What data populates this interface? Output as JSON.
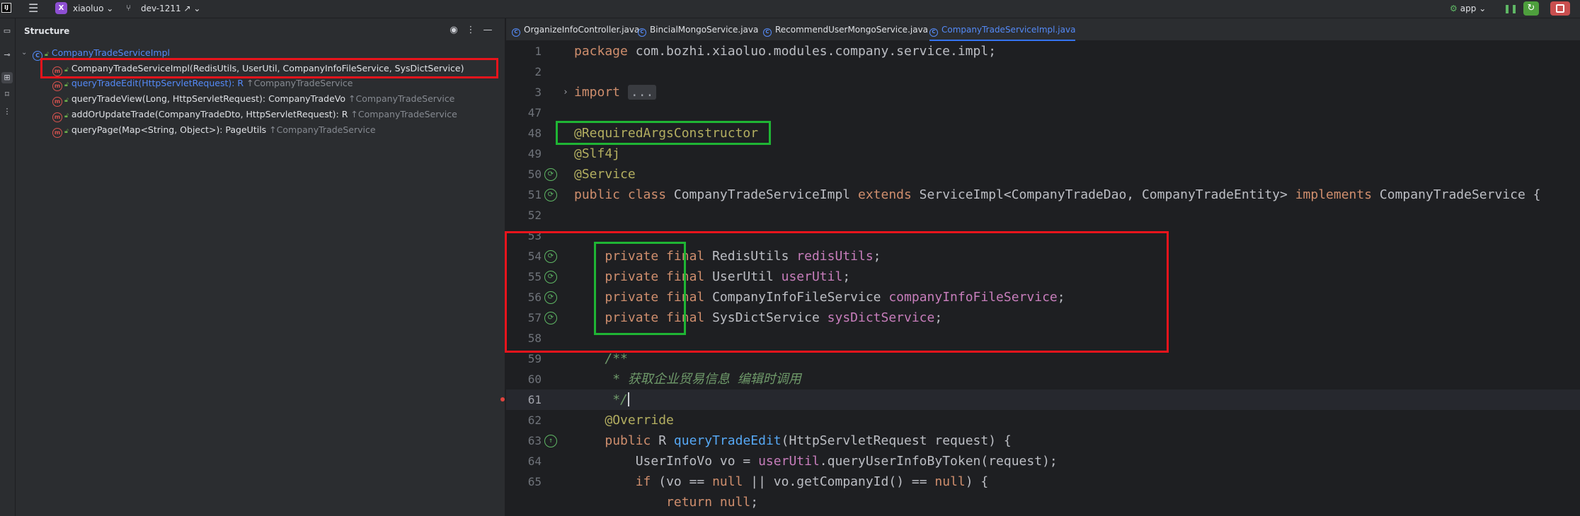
{
  "titlebar": {
    "app_logo": "IJ",
    "project_badge": "X",
    "project_name": "xiaoluo",
    "branch_name": "dev-1211 ↗",
    "run_config": "app"
  },
  "structure": {
    "title": "Structure",
    "class_node": "CompanyTradeServiceImpl",
    "items": [
      {
        "signature": "CompanyTradeServiceImpl(RedisUtils, UserUtil, CompanyInfoFileService, SysDictService)",
        "inherited": "",
        "link": false
      },
      {
        "signature": "queryTradeEdit(HttpServletRequest): R",
        "inherited": "↑CompanyTradeService",
        "link": true
      },
      {
        "signature": "queryTradeView(Long, HttpServletRequest): CompanyTradeVo",
        "inherited": "↑CompanyTradeService",
        "link": false
      },
      {
        "signature": "addOrUpdateTrade(CompanyTradeDto, HttpServletRequest): R",
        "inherited": "↑CompanyTradeService",
        "link": false
      },
      {
        "signature": "queryPage(Map<String, Object>): PageUtils",
        "inherited": "↑CompanyTradeService",
        "link": false
      }
    ]
  },
  "tabs": [
    {
      "label": "OrganizeInfoController.java",
      "active": false
    },
    {
      "label": "BincialMongoService.java",
      "active": false
    },
    {
      "label": "RecommendUserMongoService.java",
      "active": false
    },
    {
      "label": "CompanyTradeServiceImpl.java",
      "active": true
    }
  ],
  "editor": {
    "line_numbers": [
      "1",
      "2",
      "3",
      "47",
      "48",
      "49",
      "50",
      "51",
      "52",
      "53",
      "54",
      "55",
      "56",
      "57",
      "58",
      "59",
      "60",
      "61",
      "62",
      "63",
      "64",
      "65"
    ],
    "code": {
      "l1_kw": "package",
      "l1_rest": " com.bozhi.xiaoluo.modules.company.service.impl;",
      "l3_kw": "import",
      "l3_fold": "...",
      "l47": "@RequiredArgsConstructor",
      "l48": "@Slf4j",
      "l49": "@Service",
      "l50_kw1": "public class",
      "l50_a": " CompanyTradeServiceImpl ",
      "l50_kw2": "extends",
      "l50_b": " ServiceImpl<CompanyTradeDao, CompanyTradeEntity> ",
      "l50_kw3": "implements",
      "l50_c": " CompanyTradeService {",
      "pf": "private final",
      "l53_type": " RedisUtils ",
      "l53_field": "redisUtils",
      "l54_type": " UserUtil ",
      "l54_field": "userUtil",
      "l55_type": " CompanyInfoFileService ",
      "l55_field": "companyInfoFileService",
      "l56_type": " SysDictService ",
      "l56_field": "sysDictService",
      "semi": ";",
      "l58": "/**",
      "l59": " * 获取企业贸易信息 编辑时调用",
      "l60": " */",
      "l61": "@Override",
      "l62_kw": "public",
      "l62_a": " R ",
      "l62_fn": "queryTradeEdit",
      "l62_b": "(HttpServletRequest request) {",
      "l63_a": "UserInfoVo vo = ",
      "l63_fld": "userUtil",
      "l63_b": ".queryUserInfoByToken(request);",
      "l64_kw": "if",
      "l64_a": " (vo == ",
      "l64_null1": "null",
      "l64_b": " || vo.getCompanyId() == ",
      "l64_null2": "null",
      "l64_c": ") {",
      "l65_kw": "return",
      "l65_null": "null",
      "l65_semi": ";"
    }
  },
  "colors": {
    "red_box": "#e8141c",
    "green_box": "#1fb534",
    "keyword": "#cf8e6d",
    "annotation": "#b3ae60",
    "field": "#c77dbb",
    "method": "#56a8f5"
  }
}
